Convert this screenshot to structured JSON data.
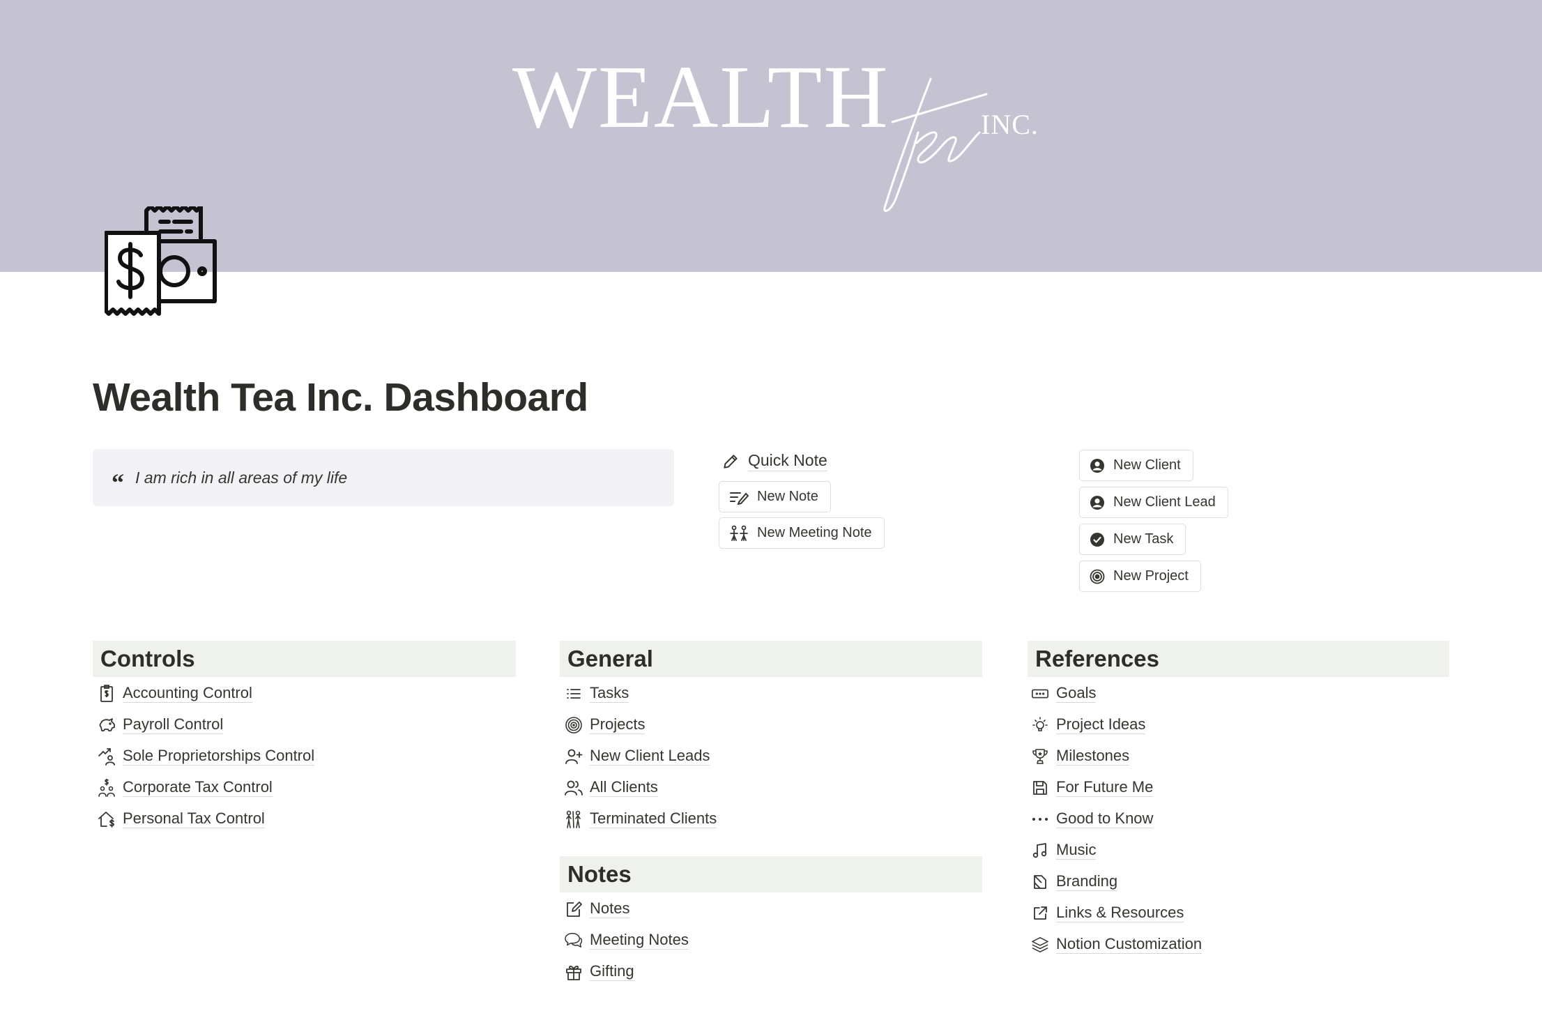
{
  "cover": {
    "logo_word": "WEALTH",
    "logo_script": "tea",
    "logo_suffix": "INC.",
    "background": "#c5c2d1"
  },
  "page_icon": "money-receipt-icon",
  "title": "Wealth Tea Inc. Dashboard",
  "quote": {
    "mark": "“",
    "text": "I am rich in all areas of my life",
    "background": "#f3f2f6"
  },
  "quick_note": {
    "label": "Quick Note",
    "icon": "pencil-icon"
  },
  "note_buttons": [
    {
      "label": "New Note",
      "icon": "note-lines-icon"
    },
    {
      "label": "New Meeting Note",
      "icon": "people-group-icon"
    }
  ],
  "client_buttons": [
    {
      "label": "New Client",
      "icon": "user-circle-icon"
    },
    {
      "label": "New Client Lead",
      "icon": "user-circle-icon"
    },
    {
      "label": "New Task",
      "icon": "check-circle-icon"
    },
    {
      "label": "New Project",
      "icon": "target-icon"
    }
  ],
  "sections": {
    "controls": {
      "heading": "Controls",
      "items": [
        {
          "label": "Accounting Control",
          "icon": "receipt-dollar-icon"
        },
        {
          "label": "Payroll Control",
          "icon": "piggy-bank-icon"
        },
        {
          "label": "Sole Proprietorships Control",
          "icon": "person-growth-icon"
        },
        {
          "label": "Corporate Tax Control",
          "icon": "people-dollar-icon"
        },
        {
          "label": "Personal Tax Control",
          "icon": "house-dollar-icon"
        }
      ]
    },
    "general": {
      "heading": "General",
      "items": [
        {
          "label": "Tasks",
          "icon": "list-icon"
        },
        {
          "label": "Projects",
          "icon": "target-icon"
        },
        {
          "label": "New Client Leads",
          "icon": "user-plus-icon"
        },
        {
          "label": "All Clients",
          "icon": "users-icon"
        },
        {
          "label": "Terminated Clients",
          "icon": "people-split-icon"
        }
      ]
    },
    "notes": {
      "heading": "Notes",
      "items": [
        {
          "label": "Notes",
          "icon": "edit-note-icon"
        },
        {
          "label": "Meeting Notes",
          "icon": "chat-bubbles-icon"
        },
        {
          "label": "Gifting",
          "icon": "gift-icon"
        }
      ]
    },
    "references": {
      "heading": "References",
      "items": [
        {
          "label": "Goals",
          "icon": "ticket-icon"
        },
        {
          "label": "Project Ideas",
          "icon": "lightbulb-icon"
        },
        {
          "label": "Milestones",
          "icon": "trophy-icon"
        },
        {
          "label": "For Future Me",
          "icon": "save-icon"
        },
        {
          "label": "Good to Know",
          "icon": "ellipsis-icon"
        },
        {
          "label": "Music",
          "icon": "music-note-icon"
        },
        {
          "label": "Branding",
          "icon": "brand-icon"
        },
        {
          "label": "Links & Resources",
          "icon": "external-link-icon"
        },
        {
          "label": "Notion Customization",
          "icon": "layers-icon"
        }
      ]
    }
  },
  "colors": {
    "section_background": "#eef1ec",
    "text": "#37352f",
    "title": "#2f2d29"
  }
}
